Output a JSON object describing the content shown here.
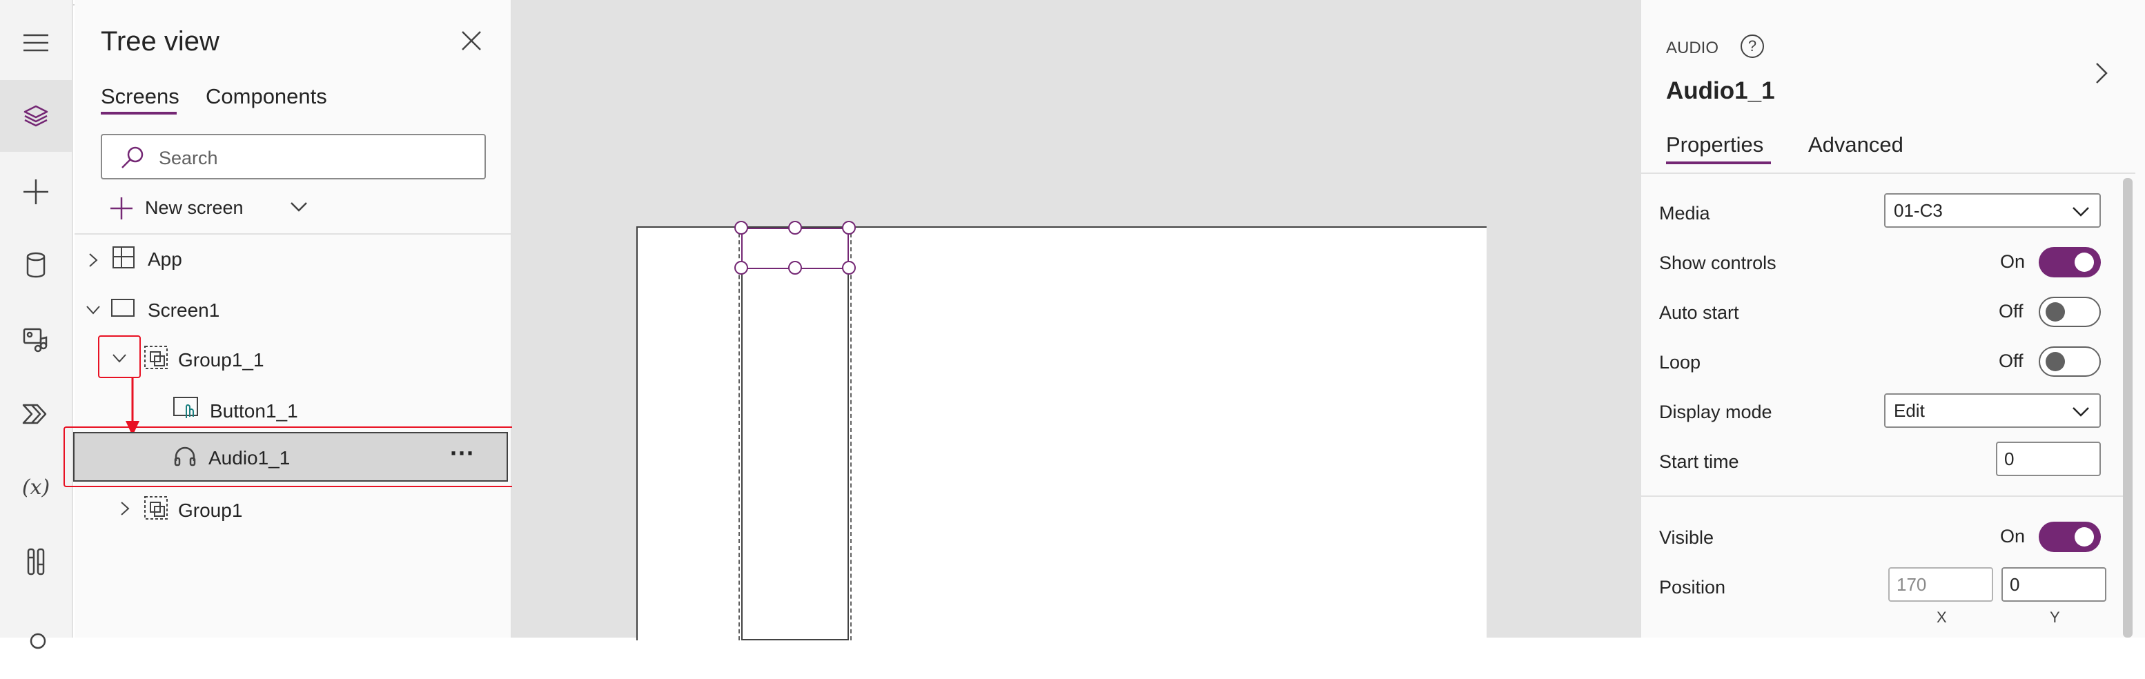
{
  "tree": {
    "title": "Tree view",
    "tabs": [
      "Screens",
      "Components"
    ],
    "search_placeholder": "Search",
    "new_screen": "New screen",
    "nodes": {
      "app": "App",
      "screen1": "Screen1",
      "group1_1": "Group1_1",
      "button1_1": "Button1_1",
      "audio1_1": "Audio1_1",
      "group1": "Group1"
    },
    "more": "···"
  },
  "props": {
    "type_label": "AUDIO",
    "control_name": "Audio1_1",
    "tabs": [
      "Properties",
      "Advanced"
    ],
    "media_label": "Media",
    "media_value": "01-C3",
    "show_controls_label": "Show controls",
    "show_controls_state": "On",
    "auto_start_label": "Auto start",
    "auto_start_state": "Off",
    "loop_label": "Loop",
    "loop_state": "Off",
    "display_mode_label": "Display mode",
    "display_mode_value": "Edit",
    "start_time_label": "Start time",
    "start_time_value": "0",
    "visible_label": "Visible",
    "visible_state": "On",
    "position_label": "Position",
    "position_x": "170",
    "position_y": "0",
    "x_caption": "X",
    "y_caption": "Y"
  },
  "colors": {
    "accent": "#742774",
    "annotation": "#e81123"
  }
}
